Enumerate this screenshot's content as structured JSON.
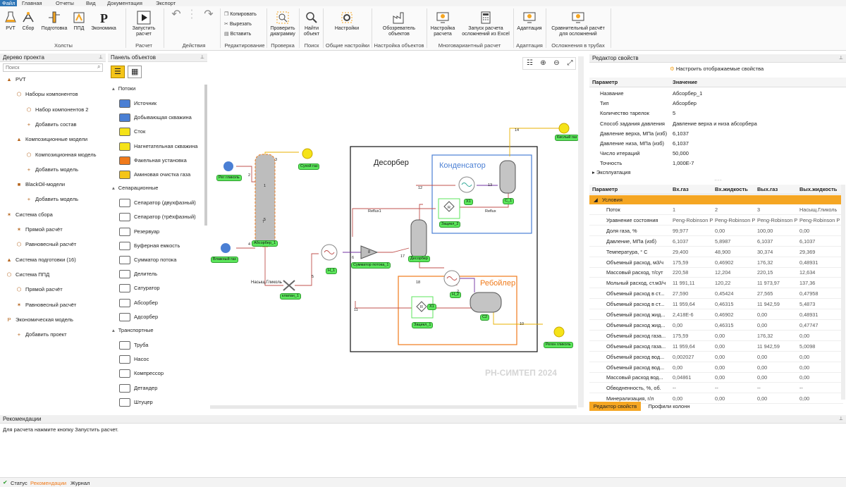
{
  "menu": [
    "Файл",
    "Главная",
    "Отчеты",
    "Вид",
    "Документация",
    "Экспорт"
  ],
  "ribbon": {
    "buttons": {
      "pvt": "PVT",
      "sbor": "Сбор",
      "podgotovka": "Подготовка",
      "ppd": "ППД",
      "ekonomika": "Экономика",
      "run": "Запустить расчет",
      "copy": "Копировать",
      "cut": "Вырезать",
      "paste": "Вставить",
      "check": "Проверить диаграмму",
      "find": "Найти объект",
      "settings": "Настройки",
      "obj_browser": "Обозреватель объектов",
      "calc_setup": "Настройка расчета",
      "excel_run": "Запуск расчета осложнений из Excel",
      "adapt": "Адаптация",
      "compare": "Сравнительный расчёт для осложнений"
    },
    "groups": {
      "holsty": "Холсты",
      "raschet": "Расчет",
      "deistviya": "Действия",
      "redakt": "Редактирование",
      "proverka": "Проверка",
      "poisk": "Поиск",
      "obshie": "Общие настройки",
      "nastr_obj": "Настройка объектов",
      "mnogovar": "Многовариантный расчет",
      "adapt": "Адаптация",
      "oslozh": "Осложнения в трубах"
    }
  },
  "project_tree": {
    "title": "Дерево проекта",
    "search_placeholder": "Поиск",
    "items": [
      "PVT",
      "Наборы компонентов",
      "Набор компонентов 2",
      "Добавить состав",
      "Композиционные модели",
      "Композиционная модель",
      "Добавить модель",
      "BlackOil-модели",
      "Добавить модель",
      "Система сбора",
      "Прямой расчёт",
      "Равновесный расчёт",
      "Система подготовки (16)",
      "Система ППД",
      "Прямой расчёт",
      "Равновесный расчёт",
      "Экономическая модель",
      "Добавить проект"
    ]
  },
  "objects_panel": {
    "title": "Панель объектов",
    "sec_flows": "Потоки",
    "flows": [
      "Источник",
      "Добывающая скважина",
      "Сток",
      "Нагнетательная скважина",
      "Факельная установка",
      "Аминовая очистка газа"
    ],
    "sec_sep": "Сепарационные",
    "sep": [
      "Сепаратор (двухфазный)",
      "Сепаратор (трёхфазный)",
      "Резервуар",
      "Буферная емкость",
      "Сумматор потока",
      "Делитель",
      "Сатуратор",
      "Абсорбер",
      "Адсорбер"
    ],
    "sec_trans": "Транспортные",
    "trans": [
      "Труба",
      "Насос",
      "Компрессор",
      "Детандер",
      "Штуцер"
    ]
  },
  "diagram": {
    "desorber": "Десорбер",
    "condenser": "Конденсатор",
    "reboiler": "Ребойлер",
    "watermark": "РН-СИМТЕП 2024",
    "tags": {
      "reg_glycol": "Рег гликоль",
      "wet_gas": "Влажный газ",
      "absorber": "Абсорбер_1",
      "dry_gas": "Сухой газ",
      "valve": "клапан_1",
      "h1": "H_1",
      "summator": "Сумматор потока_1",
      "desorber": "Десорбер",
      "h2": "H_2",
      "c1": "C_1",
      "c2": "C2",
      "zacikl1": "Зацикл_1",
      "zacikl2": "Зацикл_2",
      "sour_gas": "Кислый газ",
      "regen_glycol": "Реген гликоль",
      "x1": "X1",
      "x1b": "X1"
    },
    "labels": {
      "nasysh": "Насыщ.Гликоль",
      "reflux1": "Reflux1",
      "reflux": "Reflux"
    },
    "streams": [
      "1",
      "2",
      "3",
      "4",
      "5",
      "6",
      "7",
      "8",
      "10",
      "11",
      "12",
      "13",
      "14",
      "17",
      "18",
      "2",
      "5",
      "R",
      "R"
    ]
  },
  "props": {
    "title": "Редактор свойств",
    "configure": "Настроить отображаемые свойства",
    "col_param": "Параметр",
    "col_value": "Значение",
    "rows": [
      {
        "k": "Название",
        "v": "Абсорбер_1"
      },
      {
        "k": "Тип",
        "v": "Абсорбер"
      },
      {
        "k": "Количество тарелок",
        "v": "5"
      },
      {
        "k": "Способ задания давления",
        "v": "Давление верха и низа абсорбера"
      },
      {
        "k": "Давление верха, МПа (изб)",
        "v": "6,1037"
      },
      {
        "k": "Давление низа, МПа (изб)",
        "v": "6,1037"
      },
      {
        "k": "Число итераций",
        "v": "50,000"
      },
      {
        "k": "Точность",
        "v": "1,000E-7"
      }
    ],
    "exploit": "Эксплуатация",
    "grid_headers": [
      "Параметр",
      "Вх.газ",
      "Вх.жидкость",
      "Вых.газ",
      "Вых.жидкость"
    ],
    "conditions": "Условия",
    "grid_rows": [
      [
        "Поток",
        "1",
        "2",
        "3",
        "Насыщ.Гликоль"
      ],
      [
        "Уравнение состояния",
        "Peng-Robinson P",
        "Peng-Robinson P",
        "Peng-Robinson P",
        "Peng-Robinson P"
      ],
      [
        "Доля газа, %",
        "99,977",
        "0,00",
        "100,00",
        "0,00"
      ],
      [
        "Давление, МПа (изб)",
        "6,1037",
        "5,8987",
        "6,1037",
        "6,1037"
      ],
      [
        "Температура, ° С",
        "29,400",
        "48,900",
        "30,374",
        "29,369"
      ],
      [
        "Объемный расход, м3/ч",
        "175,59",
        "0,46902",
        "176,32",
        "0,48931"
      ],
      [
        "Массовый расход, т/сут",
        "220,58",
        "12,204",
        "220,15",
        "12,634"
      ],
      [
        "Мольный расход, ст.м3/ч",
        "11 991,11",
        "120,22",
        "11 973,97",
        "137,36"
      ],
      [
        "Объемный расход в ст...",
        "27,590",
        "0,45424",
        "27,565",
        "0,47958"
      ],
      [
        "Объемный расход в ст...",
        "11 959,64",
        "0,46315",
        "11 942,59",
        "5,4873"
      ],
      [
        "Объемный расход жид...",
        "2,418E-6",
        "0,46902",
        "0,00",
        "0,48931"
      ],
      [
        "Объемный расход жид...",
        "0,00",
        "0,46315",
        "0,00",
        "0,47747"
      ],
      [
        "Объемный расход газа...",
        "175,59",
        "0,00",
        "176,32",
        "0,00"
      ],
      [
        "Объемный расход газа...",
        "11 959,64",
        "0,00",
        "11 942,59",
        "5,0098"
      ],
      [
        "Объемный расход вод...",
        "0,002027",
        "0,00",
        "0,00",
        "0,00"
      ],
      [
        "Объемный расход вод...",
        "0,00",
        "0,00",
        "0,00",
        "0,00"
      ],
      [
        "Массовый расход вод...",
        "0,04861",
        "0,00",
        "0,00",
        "0,00"
      ],
      [
        "Обводненность, %, об.",
        "--",
        "--",
        "--",
        "--"
      ],
      [
        "Минерализация, г/л",
        "0,00",
        "0,00",
        "0,00",
        "0,00"
      ]
    ],
    "tab_props": "Редактор свойств",
    "tab_profiles": "Профили колонн"
  },
  "recommend": {
    "title": "Рекомендации",
    "text": "Для расчета нажмите кнопку Запустить расчет."
  },
  "status": {
    "status": "Статус",
    "recs": "Рекомендации",
    "journal": "Журнал"
  },
  "colors": {
    "accent": "#2e75b6",
    "ribbon_orange": "#f5a623",
    "tag_green": "#5ce65c",
    "condenser": "#4a7fd4",
    "reboiler": "#f07a1a"
  }
}
